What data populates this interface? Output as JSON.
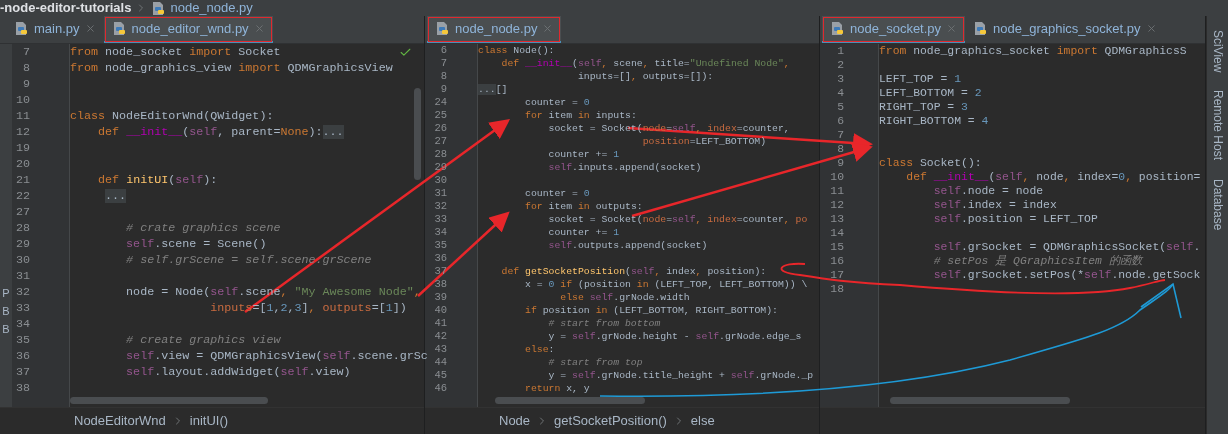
{
  "breadcrumb": {
    "project": "-node-editor-tutorials",
    "file": "node_node.py"
  },
  "panes": [
    {
      "edge_letters": [
        "P",
        "B",
        "B"
      ],
      "tabs": [
        {
          "label": "main.py",
          "selected": false,
          "highlighted": false
        },
        {
          "label": "node_editor_wnd.py",
          "selected": true,
          "highlighted": true
        }
      ],
      "lines": [
        {
          "number": "7",
          "tokens": [
            {
              "text": "from",
              "kind": "kw"
            },
            {
              "text": " node_socket ",
              "kind": "plain"
            },
            {
              "text": "import",
              "kind": "kw"
            },
            {
              "text": " Socket",
              "kind": "plain"
            }
          ]
        },
        {
          "number": "8",
          "tokens": [
            {
              "text": "from",
              "kind": "kw"
            },
            {
              "text": " node_graphics_view ",
              "kind": "plain"
            },
            {
              "text": "import",
              "kind": "kw"
            },
            {
              "text": " QDMGraphicsView",
              "kind": "plain"
            }
          ]
        },
        {
          "number": "9"
        },
        {
          "number": "10"
        },
        {
          "number": "11",
          "tokens": [
            {
              "text": "class",
              "kind": "kw"
            },
            {
              "text": " NodeEditorWnd(QWidget):",
              "kind": "plain"
            }
          ]
        },
        {
          "number": "12",
          "tokens": [
            {
              "text": "    def",
              "kind": "kw"
            },
            {
              "text": " __init__",
              "kind": "magic"
            },
            {
              "text": "(",
              "kind": "plain"
            },
            {
              "text": "self",
              "kind": "self"
            },
            {
              "text": ", parent=",
              "kind": "plain"
            },
            {
              "text": "None",
              "kind": "kw"
            },
            {
              "text": "):",
              "kind": "plain"
            },
            {
              "text": "...",
              "kind": "fold"
            }
          ]
        },
        {
          "number": "19"
        },
        {
          "number": "20"
        },
        {
          "number": "21",
          "tokens": [
            {
              "text": "    def",
              "kind": "kw"
            },
            {
              "text": " initUI",
              "kind": "fn"
            },
            {
              "text": "(",
              "kind": "plain"
            },
            {
              "text": "self",
              "kind": "self"
            },
            {
              "text": "):",
              "kind": "plain"
            }
          ]
        },
        {
          "number": "22",
          "tokens": [
            {
              "text": "     ...",
              "kind": "fold"
            }
          ]
        },
        {
          "number": "27"
        },
        {
          "number": "28",
          "tokens": [
            {
              "text": "        # crate graphics scene",
              "kind": "cmt"
            }
          ]
        },
        {
          "number": "29",
          "tokens": [
            {
              "text": "        self",
              "kind": "self"
            },
            {
              "text": ".scene = Scene()",
              "kind": "plain"
            }
          ]
        },
        {
          "number": "30",
          "tokens": [
            {
              "text": "        # self.grScene = self.scene.grScene",
              "kind": "cmt"
            }
          ]
        },
        {
          "number": "31"
        },
        {
          "number": "32",
          "tokens": [
            {
              "text": "        node = Node(",
              "kind": "plain"
            },
            {
              "text": "self",
              "kind": "self"
            },
            {
              "text": ".scene",
              "kind": "plain"
            },
            {
              "text": ", ",
              "kind": "kw"
            },
            {
              "text": "\"My Awesome Node\"",
              "kind": "str"
            },
            {
              "text": ",",
              "kind": "kw"
            }
          ]
        },
        {
          "number": "33",
          "tokens": [
            {
              "text": "                    inputs",
              "kind": "param"
            },
            {
              "text": "=[",
              "kind": "plain"
            },
            {
              "text": "1",
              "kind": "num"
            },
            {
              "text": ",",
              "kind": "plain"
            },
            {
              "text": "2",
              "kind": "num"
            },
            {
              "text": ",",
              "kind": "plain"
            },
            {
              "text": "3",
              "kind": "num"
            },
            {
              "text": "]",
              "kind": "plain"
            },
            {
              "text": ", ",
              "kind": "kw"
            },
            {
              "text": "outputs",
              "kind": "param"
            },
            {
              "text": "=[",
              "kind": "plain"
            },
            {
              "text": "1",
              "kind": "num"
            },
            {
              "text": "])",
              "kind": "plain"
            }
          ]
        },
        {
          "number": "34"
        },
        {
          "number": "35",
          "tokens": [
            {
              "text": "        # create graphics view",
              "kind": "cmt"
            }
          ]
        },
        {
          "number": "36",
          "tokens": [
            {
              "text": "        self",
              "kind": "self"
            },
            {
              "text": ".view = QDMGraphicsView(",
              "kind": "plain"
            },
            {
              "text": "self",
              "kind": "self"
            },
            {
              "text": ".scene.grSc",
              "kind": "plain"
            }
          ]
        },
        {
          "number": "37",
          "tokens": [
            {
              "text": "        self",
              "kind": "self"
            },
            {
              "text": ".layout.addWidget(",
              "kind": "plain"
            },
            {
              "text": "self",
              "kind": "self"
            },
            {
              "text": ".view)",
              "kind": "plain"
            }
          ]
        },
        {
          "number": "38"
        }
      ],
      "path": [
        "NodeEditorWnd",
        "initUI()"
      ]
    },
    {
      "tabs": [
        {
          "label": "node_node.py",
          "selected": true,
          "highlighted": true
        }
      ],
      "lines": [
        {
          "number": "6",
          "tokens": [
            {
              "text": "class",
              "kind": "kw"
            },
            {
              "text": " Node():",
              "kind": "plain"
            }
          ]
        },
        {
          "number": "7",
          "tokens": [
            {
              "text": "    def",
              "kind": "kw"
            },
            {
              "text": " __init__",
              "kind": "magic"
            },
            {
              "text": "(",
              "kind": "plain"
            },
            {
              "text": "self",
              "kind": "self"
            },
            {
              "text": ", ",
              "kind": "kw"
            },
            {
              "text": "scene",
              "kind": "plain"
            },
            {
              "text": ", ",
              "kind": "kw"
            },
            {
              "text": "title=",
              "kind": "plain"
            },
            {
              "text": "\"Undefined Node\"",
              "kind": "str"
            },
            {
              "text": ",",
              "kind": "kw"
            }
          ]
        },
        {
          "number": "8",
          "tokens": [
            {
              "text": "                 inputs=[]",
              "kind": "plain"
            },
            {
              "text": ", ",
              "kind": "kw"
            },
            {
              "text": "outputs=[]):",
              "kind": "plain"
            }
          ]
        },
        {
          "number": "9",
          "tokens": [
            {
              "text": "...",
              "kind": "fold"
            },
            {
              "text": "[]",
              "kind": "plain"
            }
          ]
        },
        {
          "number": "24",
          "tokens": [
            {
              "text": "        counter = ",
              "kind": "plain"
            },
            {
              "text": "0",
              "kind": "num"
            }
          ]
        },
        {
          "number": "25",
          "tokens": [
            {
              "text": "        for",
              "kind": "kw"
            },
            {
              "text": " item ",
              "kind": "plain"
            },
            {
              "text": "in",
              "kind": "kw"
            },
            {
              "text": " inputs:",
              "kind": "plain"
            }
          ]
        },
        {
          "number": "26",
          "tokens": [
            {
              "text": "            socket = Socket(",
              "kind": "plain"
            },
            {
              "text": "node",
              "kind": "param"
            },
            {
              "text": "=",
              "kind": "plain"
            },
            {
              "text": "self",
              "kind": "self"
            },
            {
              "text": ", ",
              "kind": "kw"
            },
            {
              "text": "index",
              "kind": "param"
            },
            {
              "text": "=counter,",
              "kind": "plain"
            }
          ]
        },
        {
          "number": "27",
          "tokens": [
            {
              "text": "                            position",
              "kind": "param"
            },
            {
              "text": "=LEFT_BOTTOM)",
              "kind": "plain"
            }
          ]
        },
        {
          "number": "28",
          "tokens": [
            {
              "text": "            counter += ",
              "kind": "plain"
            },
            {
              "text": "1",
              "kind": "num"
            }
          ]
        },
        {
          "number": "29",
          "tokens": [
            {
              "text": "            self",
              "kind": "self"
            },
            {
              "text": ".inputs.append(socket)",
              "kind": "plain"
            }
          ]
        },
        {
          "number": "30"
        },
        {
          "number": "31",
          "tokens": [
            {
              "text": "        counter = ",
              "kind": "plain"
            },
            {
              "text": "0",
              "kind": "num"
            }
          ]
        },
        {
          "number": "32",
          "tokens": [
            {
              "text": "        for",
              "kind": "kw"
            },
            {
              "text": " item ",
              "kind": "plain"
            },
            {
              "text": "in",
              "kind": "kw"
            },
            {
              "text": " outputs:",
              "kind": "plain"
            }
          ]
        },
        {
          "number": "33",
          "tokens": [
            {
              "text": "            socket = Socket(",
              "kind": "plain"
            },
            {
              "text": "node",
              "kind": "param"
            },
            {
              "text": "=",
              "kind": "plain"
            },
            {
              "text": "self",
              "kind": "self"
            },
            {
              "text": ", ",
              "kind": "kw"
            },
            {
              "text": "index",
              "kind": "param"
            },
            {
              "text": "=counter",
              "kind": "plain"
            },
            {
              "text": ", ",
              "kind": "kw"
            },
            {
              "text": "po",
              "kind": "param"
            }
          ]
        },
        {
          "number": "34",
          "tokens": [
            {
              "text": "            counter += ",
              "kind": "plain"
            },
            {
              "text": "1",
              "kind": "num"
            }
          ]
        },
        {
          "number": "35",
          "tokens": [
            {
              "text": "            self",
              "kind": "self"
            },
            {
              "text": ".outputs.append(socket)",
              "kind": "plain"
            }
          ]
        },
        {
          "number": "36"
        },
        {
          "number": "37",
          "tokens": [
            {
              "text": "    def",
              "kind": "kw"
            },
            {
              "text": " getSocketPosition",
              "kind": "fn"
            },
            {
              "text": "(",
              "kind": "plain"
            },
            {
              "text": "self",
              "kind": "self"
            },
            {
              "text": ", ",
              "kind": "kw"
            },
            {
              "text": "index",
              "kind": "plain"
            },
            {
              "text": ", ",
              "kind": "kw"
            },
            {
              "text": "position):",
              "kind": "plain"
            }
          ]
        },
        {
          "number": "38",
          "tokens": [
            {
              "text": "        x = ",
              "kind": "plain"
            },
            {
              "text": "0",
              "kind": "num"
            },
            {
              "text": " if",
              "kind": "kw"
            },
            {
              "text": " (position ",
              "kind": "plain"
            },
            {
              "text": "in",
              "kind": "kw"
            },
            {
              "text": " (LEFT_TOP, LEFT_BOTTOM)) \\",
              "kind": "plain"
            }
          ]
        },
        {
          "number": "39",
          "tokens": [
            {
              "text": "              else",
              "kind": "kw"
            },
            {
              "text": " self",
              "kind": "self"
            },
            {
              "text": ".grNode.width",
              "kind": "plain"
            }
          ]
        },
        {
          "number": "40",
          "tokens": [
            {
              "text": "        if",
              "kind": "kw"
            },
            {
              "text": " position ",
              "kind": "plain"
            },
            {
              "text": "in",
              "kind": "kw"
            },
            {
              "text": " (LEFT_BOTTOM, RIGHT_BOTTOM):",
              "kind": "plain"
            }
          ]
        },
        {
          "number": "41",
          "tokens": [
            {
              "text": "            # start from bottom",
              "kind": "cmt"
            }
          ]
        },
        {
          "number": "42",
          "tokens": [
            {
              "text": "            y = ",
              "kind": "plain"
            },
            {
              "text": "self",
              "kind": "self"
            },
            {
              "text": ".grNode.height - ",
              "kind": "plain"
            },
            {
              "text": "self",
              "kind": "self"
            },
            {
              "text": ".grNode.edge_s",
              "kind": "plain"
            }
          ]
        },
        {
          "number": "43",
          "tokens": [
            {
              "text": "        else",
              "kind": "kw"
            },
            {
              "text": ":",
              "kind": "plain"
            }
          ]
        },
        {
          "number": "44",
          "tokens": [
            {
              "text": "            # start from top",
              "kind": "cmt"
            }
          ]
        },
        {
          "number": "45",
          "tokens": [
            {
              "text": "            y = ",
              "kind": "plain"
            },
            {
              "text": "self",
              "kind": "self"
            },
            {
              "text": ".grNode.title_height + ",
              "kind": "plain"
            },
            {
              "text": "self",
              "kind": "self"
            },
            {
              "text": ".grNode._p",
              "kind": "plain"
            }
          ]
        },
        {
          "number": "46",
          "tokens": [
            {
              "text": "        return",
              "kind": "kw"
            },
            {
              "text": " x, y",
              "kind": "plain"
            }
          ]
        }
      ],
      "path": [
        "Node",
        "getSocketPosition()",
        "else"
      ]
    },
    {
      "tabs": [
        {
          "label": "node_socket.py",
          "selected": true,
          "highlighted": true
        },
        {
          "label": "node_graphics_socket.py",
          "selected": false,
          "highlighted": false
        }
      ],
      "lines": [
        {
          "number": "1",
          "tokens": [
            {
              "text": "from",
              "kind": "kw"
            },
            {
              "text": " node_graphics_socket ",
              "kind": "plain"
            },
            {
              "text": "import",
              "kind": "kw"
            },
            {
              "text": " QDMGraphicsS",
              "kind": "plain"
            }
          ]
        },
        {
          "number": "2"
        },
        {
          "number": "3",
          "tokens": [
            {
              "text": "LEFT_TOP = ",
              "kind": "plain"
            },
            {
              "text": "1",
              "kind": "num"
            }
          ]
        },
        {
          "number": "4",
          "tokens": [
            {
              "text": "LEFT_BOTTOM = ",
              "kind": "plain"
            },
            {
              "text": "2",
              "kind": "num"
            }
          ]
        },
        {
          "number": "5",
          "tokens": [
            {
              "text": "RIGHT_TOP = ",
              "kind": "plain"
            },
            {
              "text": "3",
              "kind": "num"
            }
          ]
        },
        {
          "number": "6",
          "tokens": [
            {
              "text": "RIGHT_BOTTOM = ",
              "kind": "plain"
            },
            {
              "text": "4",
              "kind": "num"
            }
          ]
        },
        {
          "number": "7"
        },
        {
          "number": "8"
        },
        {
          "number": "9",
          "tokens": [
            {
              "text": "class",
              "kind": "kw"
            },
            {
              "text": " Socket():",
              "kind": "plain"
            }
          ]
        },
        {
          "number": "10",
          "tokens": [
            {
              "text": "    def",
              "kind": "kw"
            },
            {
              "text": " __init__",
              "kind": "magic"
            },
            {
              "text": "(",
              "kind": "plain"
            },
            {
              "text": "self",
              "kind": "self"
            },
            {
              "text": ", ",
              "kind": "kw"
            },
            {
              "text": "node",
              "kind": "plain"
            },
            {
              "text": ", ",
              "kind": "kw"
            },
            {
              "text": "index=",
              "kind": "plain"
            },
            {
              "text": "0",
              "kind": "num"
            },
            {
              "text": ", ",
              "kind": "kw"
            },
            {
              "text": "position=",
              "kind": "plain"
            }
          ]
        },
        {
          "number": "11",
          "tokens": [
            {
              "text": "        self",
              "kind": "self"
            },
            {
              "text": ".node = node",
              "kind": "plain"
            }
          ]
        },
        {
          "number": "12",
          "tokens": [
            {
              "text": "        self",
              "kind": "self"
            },
            {
              "text": ".index = index",
              "kind": "plain"
            }
          ]
        },
        {
          "number": "13",
          "tokens": [
            {
              "text": "        self",
              "kind": "self"
            },
            {
              "text": ".position = LEFT_TOP",
              "kind": "plain"
            }
          ]
        },
        {
          "number": "14"
        },
        {
          "number": "15",
          "tokens": [
            {
              "text": "        self",
              "kind": "self"
            },
            {
              "text": ".grSocket = QDMGraphicsSocket(",
              "kind": "plain"
            },
            {
              "text": "self",
              "kind": "self"
            },
            {
              "text": ".",
              "kind": "plain"
            }
          ]
        },
        {
          "number": "16",
          "tokens": [
            {
              "text": "        # setPos 是 QGraphicsItem 的函数",
              "kind": "cmt"
            }
          ]
        },
        {
          "number": "17",
          "tokens": [
            {
              "text": "        self",
              "kind": "self"
            },
            {
              "text": ".grSocket.setPos(*",
              "kind": "plain"
            },
            {
              "text": "self",
              "kind": "self"
            },
            {
              "text": ".node.getSock",
              "kind": "plain"
            }
          ]
        },
        {
          "number": "18"
        }
      ]
    }
  ],
  "tool_windows": [
    "SciView",
    "Remote Host",
    "Database"
  ]
}
